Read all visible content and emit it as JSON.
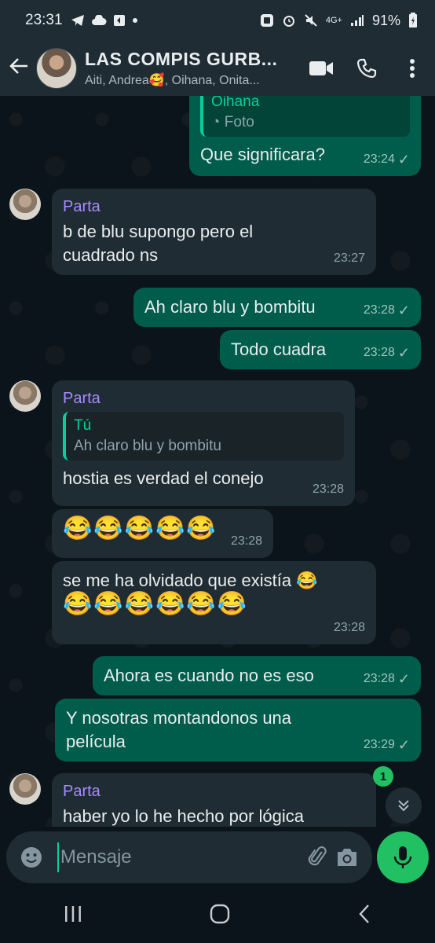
{
  "status_bar": {
    "time": "23:31",
    "icons_left": [
      "telegram-icon",
      "cloud-icon",
      "app-icon",
      "dot-icon"
    ],
    "icons_right": [
      "samsung-icon",
      "alarm-icon",
      "mute-icon",
      "lte-icon",
      "signal-icon"
    ],
    "network": "4G+",
    "battery": "91%"
  },
  "header": {
    "back_icon": "arrow-left-icon",
    "title": "LAS  COMPIS GURB...",
    "subtitle": "Aiti, Andrea🥰, Oihana, Onita...",
    "actions": [
      "video-call-icon",
      "phone-icon",
      "more-vert-icon"
    ]
  },
  "messages": [
    {
      "type": "out",
      "quote_name": "Oihana",
      "quote_media": "Foto",
      "text": "Que significara?",
      "time": "23:24",
      "status": "✓"
    },
    {
      "type": "in",
      "sender": "Parta",
      "text_line1": "b de blu supongo pero el",
      "text_line2": "cuadrado ns",
      "time": "23:27"
    },
    {
      "type": "out",
      "text": "Ah claro blu y bombitu",
      "time": "23:28",
      "status": "✓"
    },
    {
      "type": "out",
      "text": "Todo cuadra",
      "time": "23:28",
      "status": "✓"
    },
    {
      "type": "in",
      "sender": "Parta",
      "quote_name": "Tú",
      "quote_text": "Ah claro blu y bombitu",
      "text": "hostia es verdad el conejo",
      "time": "23:28"
    },
    {
      "type": "in",
      "text": "😂😂😂😂😂",
      "time": "23:28"
    },
    {
      "type": "in",
      "text_line1": "se me ha olvidado que existía 😂",
      "text_line2": "😂😂😂😂😂😂",
      "time": "23:28"
    },
    {
      "type": "out",
      "text": "Ahora es cuando no es eso",
      "time": "23:28",
      "status": "✓"
    },
    {
      "type": "out",
      "text_line1": "Y nosotras  montandonos   una",
      "text_line2": "película",
      "time": "23:29",
      "status": "✓"
    },
    {
      "type": "in",
      "sender": "Parta",
      "text": "haber yo lo he hecho por lógica"
    }
  ],
  "unread_count": "1",
  "composer": {
    "placeholder": "Mensaje",
    "icons": [
      "emoji-icon",
      "attach-icon",
      "camera-icon",
      "mic-icon"
    ]
  },
  "navbar": [
    "recent-apps-icon",
    "home-icon",
    "back-nav-icon"
  ],
  "colors": {
    "background": "#0b141a",
    "bar": "#1f2c34",
    "incoming": "#202c33",
    "outgoing": "#005c4b",
    "accent_green": "#21c063",
    "sender_name": "#a68cff",
    "quote_accent": "#06cf9c"
  }
}
